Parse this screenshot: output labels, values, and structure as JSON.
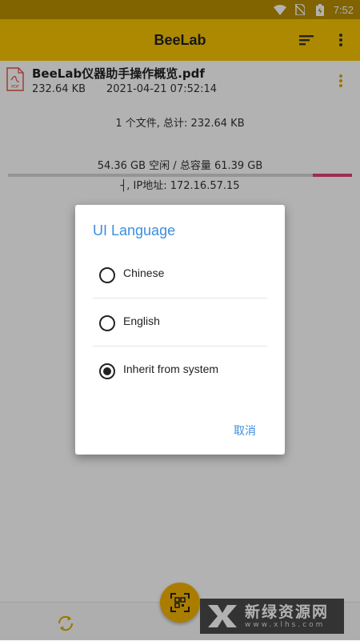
{
  "status_bar": {
    "time": "7:52"
  },
  "app_bar": {
    "title": "BeeLab"
  },
  "file": {
    "name": "BeeLab仪器助手操作概览.pdf",
    "size": "232.64 KB",
    "date": "2021-04-21 07:52:14",
    "icon_label": "PDF"
  },
  "summary": "1 个文件, 总计: 232.64 KB",
  "storage": {
    "text": "54.36 GB 空闲 / 总容量 61.39 GB",
    "used_fraction": 0.115
  },
  "ip_line": "┤, IP地址: 172.16.57.15",
  "dialog": {
    "title": "UI Language",
    "options": [
      {
        "label": "Chinese",
        "selected": false
      },
      {
        "label": "English",
        "selected": false
      },
      {
        "label": "Inherit from system",
        "selected": true
      }
    ],
    "cancel_label": "取消"
  },
  "watermark": {
    "main": "新绿资源网",
    "sub": "www.xlhs.com"
  },
  "colors": {
    "accent": "#f6c500",
    "status_bar": "#b98f00",
    "dialog_accent": "#3d8ee0",
    "storage_used": "#e0407a"
  },
  "icons": [
    "wifi-icon",
    "no-sim-icon",
    "battery-icon",
    "sort-icon",
    "more-vert-icon",
    "pdf-file-icon",
    "refresh-icon",
    "qr-scan-icon"
  ]
}
